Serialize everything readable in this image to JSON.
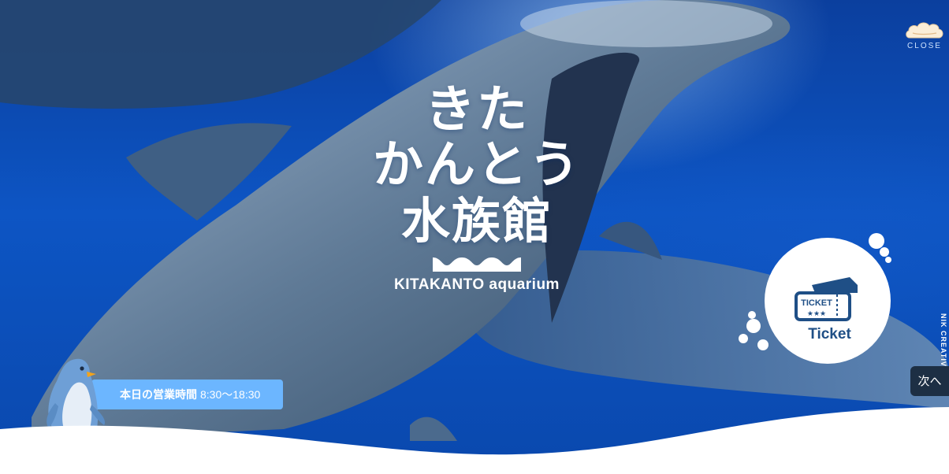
{
  "logo": {
    "line1": "きた",
    "line2": "かんとう",
    "line3": "水族館",
    "sub": "KITAKANTO aquarium"
  },
  "close_button": {
    "label": "CLOSE",
    "icon": "cloud-icon"
  },
  "ticket_button": {
    "label": "Ticket",
    "icon": "ticket-icon",
    "icon_text": "TICKET"
  },
  "next_button": {
    "label": "次へ"
  },
  "credit": {
    "text": "NIK CREATIVE"
  },
  "hours": {
    "label": "本日の営業時間",
    "time": "8:30〜18:30"
  },
  "colors": {
    "ocean": "#0d55c4",
    "hours_bar": "#6cb6ff",
    "ticket_text": "#1f4f86",
    "next_bg": "#1d2f44"
  }
}
